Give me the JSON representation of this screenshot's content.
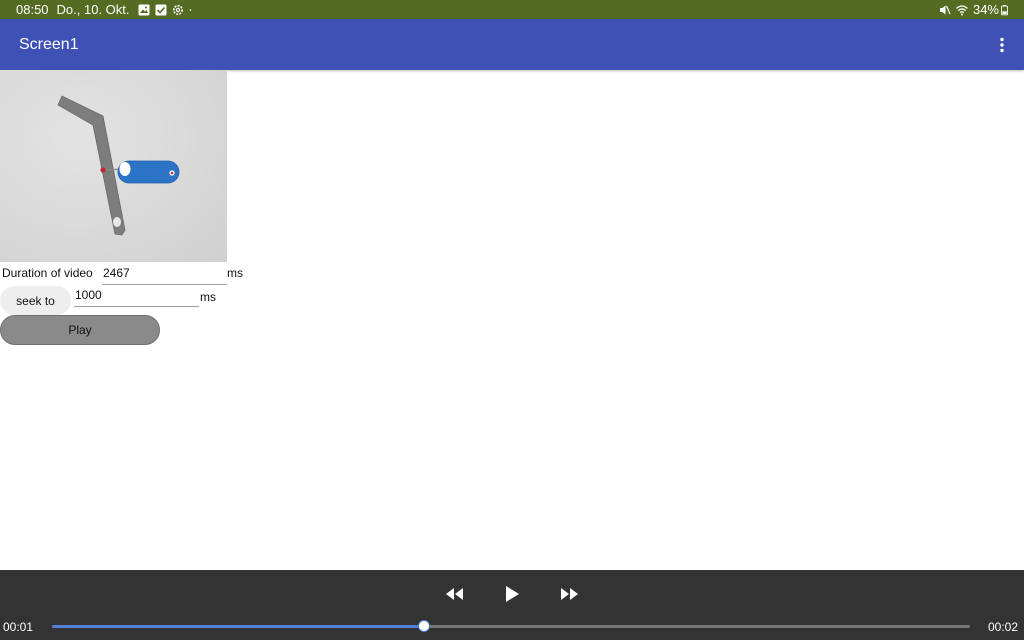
{
  "status_bar": {
    "time": "08:50",
    "date": "Do., 10. Okt.",
    "battery": "34%",
    "icons_left": [
      "gallery-icon",
      "checkbox-icon",
      "settings-gear-icon",
      "dot-icon"
    ],
    "icons_right": [
      "mute-icon",
      "wifi-icon",
      "battery-icon"
    ]
  },
  "app_bar": {
    "title": "Screen1",
    "menu_icon": "more-vertical-icon"
  },
  "form": {
    "duration_label": "Duration of video",
    "duration_value": "2467",
    "duration_unit": "ms",
    "seek_button_label": "seek to",
    "seek_value": "1000",
    "seek_unit": "ms",
    "play_button_label": "Play"
  },
  "media_controls": {
    "elapsed": "00:01",
    "total": "00:02",
    "progress_fraction": 0.405,
    "buttons": [
      "rewind-icon",
      "play-icon",
      "fast-forward-icon"
    ]
  },
  "colors": {
    "status_bar": "#556b22",
    "app_bar": "#3f51b5",
    "controls_bg": "#333333",
    "progress": "#4f7fd6",
    "link_blue": "#2b73c6"
  }
}
